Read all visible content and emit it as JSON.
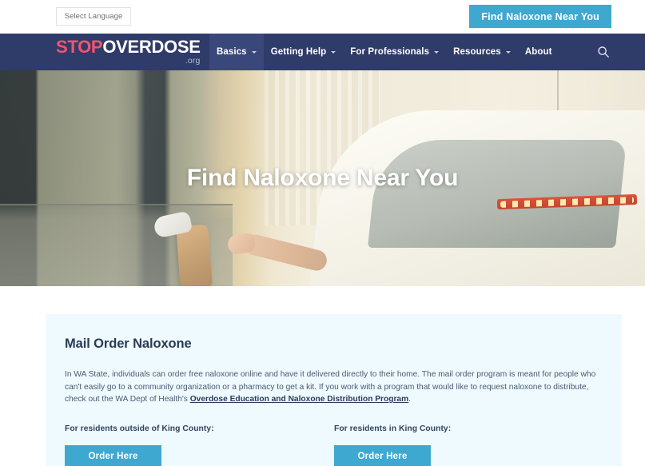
{
  "utility_bar": {
    "language_selector_label": "Select Language",
    "find_naloxone_button": "Find Naloxone Near You"
  },
  "navbar": {
    "logo": {
      "part_stop": "STOP",
      "part_overdose": "OVERDOSE",
      "part_org": ".org",
      "color_stop": "#f2556b",
      "color_overdose": "#ffffff"
    },
    "background_color": "#2f3b69",
    "search_icon": "search-icon",
    "items": [
      {
        "label": "Basics",
        "has_dropdown": true,
        "active": true
      },
      {
        "label": "Getting Help",
        "has_dropdown": true,
        "active": false
      },
      {
        "label": "For Professionals",
        "has_dropdown": true,
        "active": false
      },
      {
        "label": "Resources",
        "has_dropdown": true,
        "active": false
      },
      {
        "label": "About",
        "has_dropdown": false,
        "active": false
      }
    ]
  },
  "hero": {
    "title": "Find Naloxone Near You",
    "image_description": "Gloved hand passing a paper bag through a drive-thru window to a person reaching out of a white car"
  },
  "main": {
    "card": {
      "title": "Mail Order Naloxone",
      "paragraph_before_link": "In WA State, individuals can order free naloxone online and have it delivered directly to their home. The mail order program is meant for people who can't easily go to a community organization or a pharmacy to get a kit. If you work with a program that would like to request naloxone to distribute, check out the WA Dept of Health's ",
      "paragraph_link": "Overdose Education and Naloxone Distribution Program",
      "paragraph_after_link": ".",
      "background_color": "#eefaff",
      "cta_columns": [
        {
          "label": "For residents outside of King County:",
          "button": "Order Here"
        },
        {
          "label": "For residents in King County:",
          "button": "Order Here"
        }
      ]
    }
  },
  "theme": {
    "accent_blue": "#3fa8d0",
    "navy": "#2f3b69",
    "card_bg": "#eefaff"
  }
}
